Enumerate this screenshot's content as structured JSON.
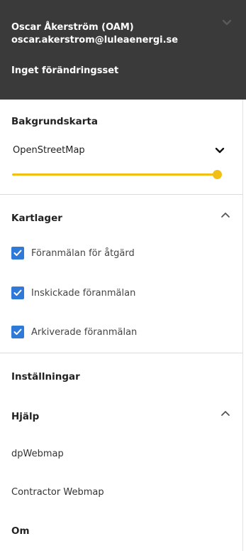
{
  "header": {
    "user_name": "Oscar Åkerström (OAM)",
    "user_email": "oscar.akerstrom@luleaenergi.se",
    "changeset": "Inget förändringsset",
    "chevron_icon": "chevron-down-icon"
  },
  "background_map": {
    "title": "Bakgrundskarta",
    "selected": "OpenStreetMap",
    "opacity_percent": 100
  },
  "layers": {
    "title": "Kartlager",
    "items": [
      {
        "label": "Föranmälan för åtgärd",
        "checked": true
      },
      {
        "label": "Inskickade föranmälan",
        "checked": true
      },
      {
        "label": "Arkiverade föranmälan",
        "checked": true
      }
    ]
  },
  "settings": {
    "title": "Inställningar"
  },
  "help": {
    "title": "Hjälp",
    "items": [
      {
        "label": "dpWebmap"
      },
      {
        "label": "Contractor Webmap"
      }
    ]
  },
  "about": {
    "title": "Om"
  },
  "colors": {
    "header_bg": "#3a3a3a",
    "accent_yellow": "#f2c014",
    "checkbox_blue": "#2f7ad8"
  }
}
